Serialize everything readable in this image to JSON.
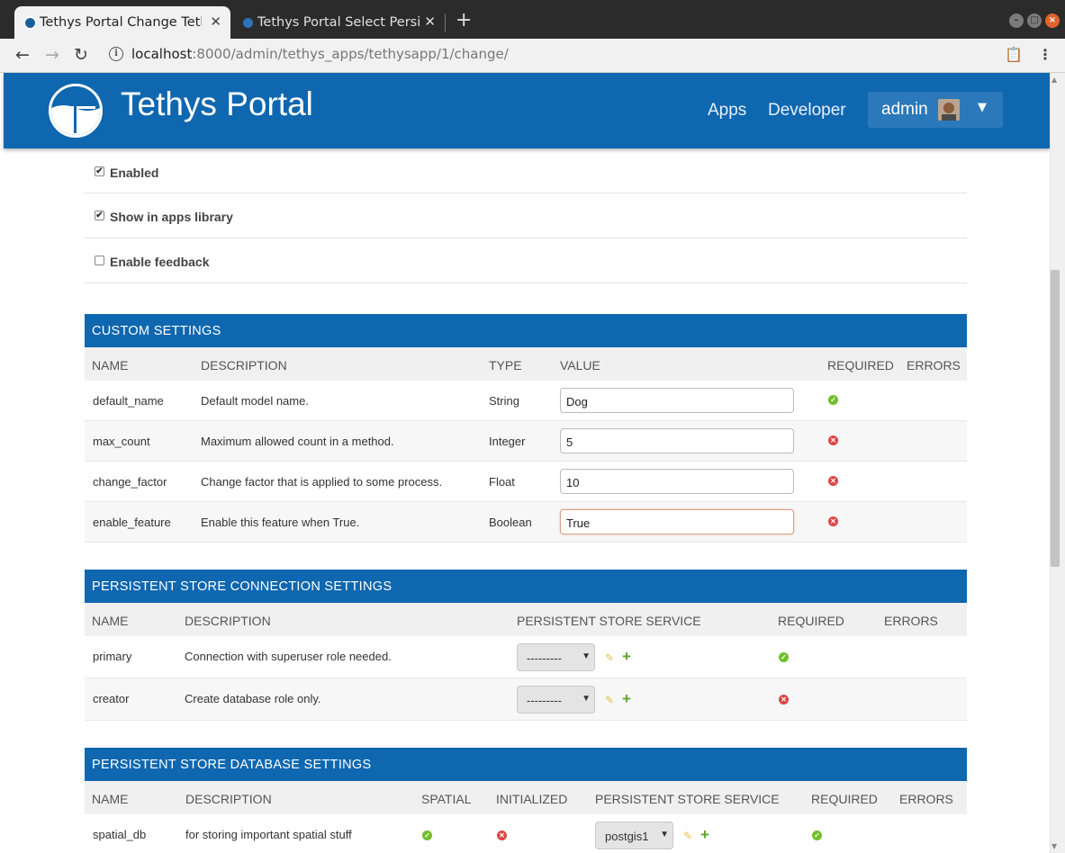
{
  "browser": {
    "tabs": [
      {
        "title": "Tethys Portal Change Teth"
      },
      {
        "title": "Tethys Portal Select Persis"
      }
    ],
    "url_host": "localhost",
    "url_rest": ":8000/admin/tethys_apps/tethysapp/1/change/"
  },
  "header": {
    "brand": "Tethys Portal",
    "nav": [
      "Apps",
      "Developer"
    ],
    "user": "admin"
  },
  "checkboxes": [
    {
      "label": "Enabled",
      "checked": true
    },
    {
      "label": "Show in apps library",
      "checked": true
    },
    {
      "label": "Enable feedback",
      "checked": false
    }
  ],
  "custom_settings": {
    "caption": "CUSTOM SETTINGS",
    "headers": [
      "NAME",
      "DESCRIPTION",
      "TYPE",
      "VALUE",
      "REQUIRED",
      "ERRORS"
    ],
    "rows": [
      {
        "name": "default_name",
        "description": "Default model name.",
        "type": "String",
        "value": "Dog",
        "required": true
      },
      {
        "name": "max_count",
        "description": "Maximum allowed count in a method.",
        "type": "Integer",
        "value": "5",
        "required": false
      },
      {
        "name": "change_factor",
        "description": "Change factor that is applied to some process.",
        "type": "Float",
        "value": "10",
        "required": false
      },
      {
        "name": "enable_feature",
        "description": "Enable this feature when True.",
        "type": "Boolean",
        "value": "True",
        "required": false
      }
    ]
  },
  "ps_connection": {
    "caption": "PERSISTENT STORE CONNECTION SETTINGS",
    "headers": [
      "NAME",
      "DESCRIPTION",
      "PERSISTENT STORE SERVICE",
      "REQUIRED",
      "ERRORS"
    ],
    "rows": [
      {
        "name": "primary",
        "description": "Connection with superuser role needed.",
        "service": "---------",
        "required": true
      },
      {
        "name": "creator",
        "description": "Create database role only.",
        "service": "---------",
        "required": false
      }
    ]
  },
  "ps_database": {
    "caption": "PERSISTENT STORE DATABASE SETTINGS",
    "headers": [
      "NAME",
      "DESCRIPTION",
      "SPATIAL",
      "INITIALIZED",
      "PERSISTENT STORE SERVICE",
      "REQUIRED",
      "ERRORS"
    ],
    "rows": [
      {
        "name": "spatial_db",
        "description": "for storing important spatial stuff",
        "spatial": true,
        "initialized": false,
        "service": "postgis1",
        "required": true
      }
    ]
  },
  "colors": {
    "brand_blue": "#0f67b0",
    "ok_green": "#70bf2b",
    "error_red": "#dd4646"
  }
}
